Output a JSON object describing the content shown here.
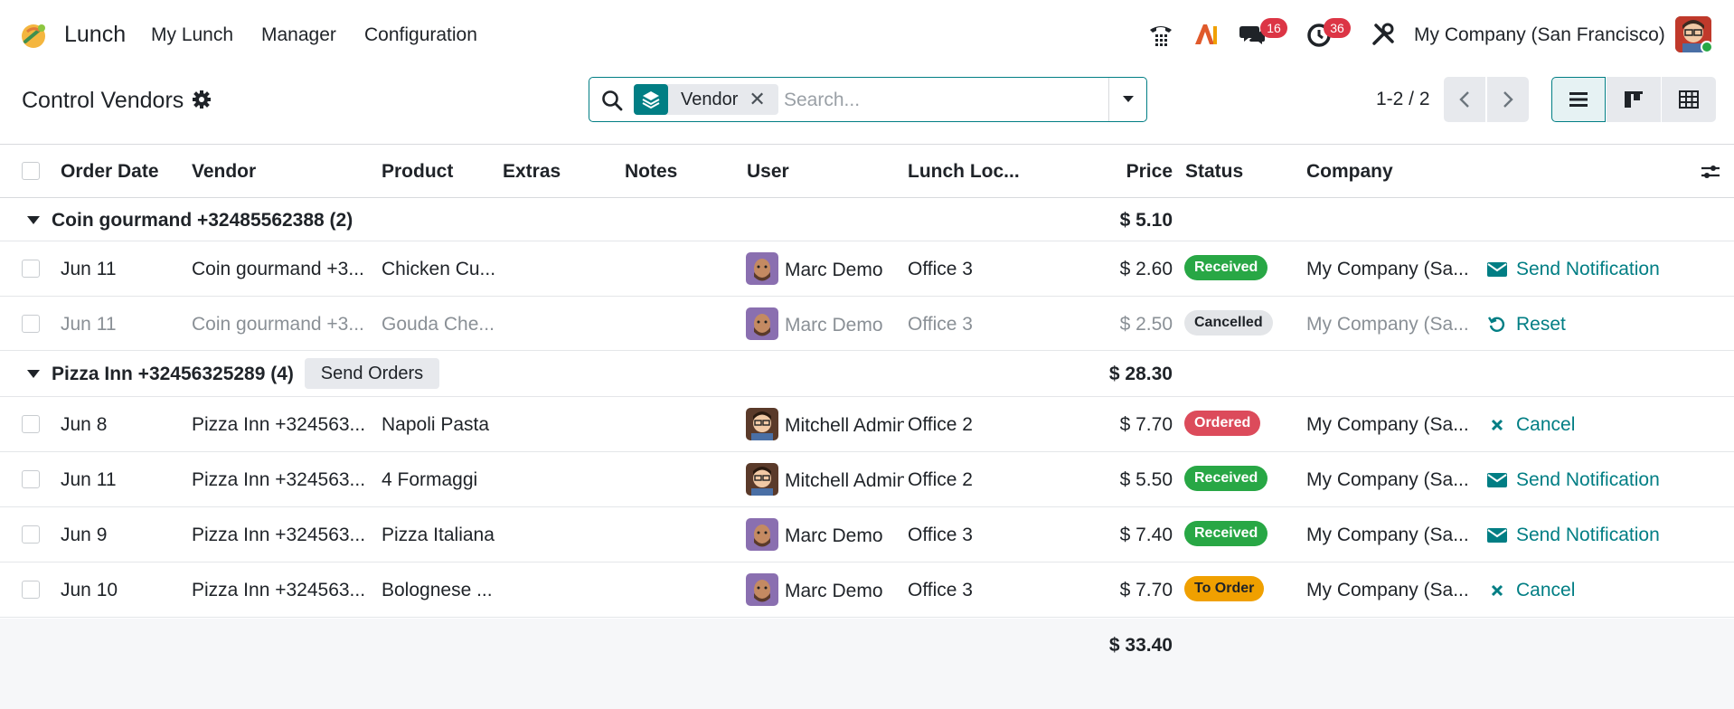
{
  "navbar": {
    "app_name": "Lunch",
    "menus": [
      "My Lunch",
      "Manager",
      "Configuration"
    ],
    "messages_count": "16",
    "activities_count": "36",
    "company": "My Company (San Francisco)"
  },
  "control_panel": {
    "title": "Control Vendors",
    "facet_label": "Vendor",
    "search_placeholder": "Search...",
    "pager": "1-2 / 2"
  },
  "columns": [
    "Order Date",
    "Vendor",
    "Product",
    "Extras",
    "Notes",
    "User",
    "Lunch Loc...",
    "Price",
    "Status",
    "Company"
  ],
  "groups": [
    {
      "title": "Coin gourmand +32485562388 (2)",
      "total": "$ 5.10",
      "rows": [
        {
          "date": "Jun 11",
          "vendor": "Coin gourmand +3...",
          "product": "Chicken Cu...",
          "user": "Marc Demo",
          "location": "Office 3",
          "price": "$ 2.60",
          "status": "Received",
          "company": "My Company (Sa...",
          "action": "Send Notification"
        },
        {
          "date": "Jun 11",
          "vendor": "Coin gourmand +3...",
          "product": "Gouda Che...",
          "user": "Marc Demo",
          "location": "Office 3",
          "price": "$ 2.50",
          "status": "Cancelled",
          "company": "My Company (Sa...",
          "action": "Reset"
        }
      ]
    },
    {
      "title": "Pizza Inn +32456325289 (4)",
      "button": "Send Orders",
      "total": "$ 28.30",
      "rows": [
        {
          "date": "Jun 8",
          "vendor": "Pizza Inn +324563...",
          "product": "Napoli Pasta",
          "user": "Mitchell Admin",
          "location": "Office 2",
          "price": "$ 7.70",
          "status": "Ordered",
          "company": "My Company (Sa...",
          "action": "Cancel"
        },
        {
          "date": "Jun 11",
          "vendor": "Pizza Inn +324563...",
          "product": "4 Formaggi",
          "user": "Mitchell Admin",
          "location": "Office 2",
          "price": "$ 5.50",
          "status": "Received",
          "company": "My Company (Sa...",
          "action": "Send Notification"
        },
        {
          "date": "Jun 9",
          "vendor": "Pizza Inn +324563...",
          "product": "Pizza Italiana",
          "user": "Marc Demo",
          "location": "Office 3",
          "price": "$ 7.40",
          "status": "Received",
          "company": "My Company (Sa...",
          "action": "Send Notification"
        },
        {
          "date": "Jun 10",
          "vendor": "Pizza Inn +324563...",
          "product": "Bolognese ...",
          "user": "Marc Demo",
          "location": "Office 3",
          "price": "$ 7.70",
          "status": "To Order",
          "company": "My Company (Sa...",
          "action": "Cancel"
        }
      ]
    }
  ],
  "grand_total": "$ 33.40",
  "colors": {
    "accent": "#017e84",
    "received": "#28a745",
    "ordered": "#dc4b5b",
    "to_order": "#f0a000",
    "badge": "#dc3545"
  }
}
